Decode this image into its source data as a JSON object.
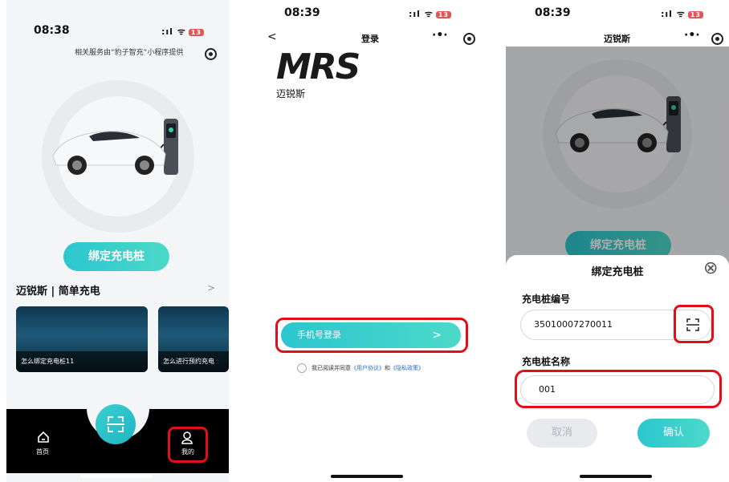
{
  "phone1": {
    "time": "08:38",
    "signal": ":ıl",
    "battery": "13",
    "provider_notice": "相关服务由“豹子智充”小程序提供",
    "bind_button": "绑定充电桩",
    "section_title": "迈锐斯 | 简单充电",
    "section_arrow": ">",
    "videos": [
      {
        "caption": "怎么绑定充电桩11"
      },
      {
        "caption": "怎么进行预约充电"
      }
    ],
    "tabs": {
      "home": "首页",
      "mine": "我的"
    },
    "colors": {
      "teal": "#2bc6cf",
      "highlight": "#e0101a"
    }
  },
  "phone2": {
    "time": "08:39",
    "signal": ":ıl",
    "battery": "13",
    "back": "<",
    "title": "登录",
    "logo_text": "MRS",
    "brand_name": "迈锐斯",
    "phone_login_button": "手机号登录",
    "phone_login_arrow": ">",
    "agreement_prefix": "我已阅读并同意",
    "user_agreement": "《用户协议》",
    "and": "和",
    "privacy_policy": "《隐私政策》",
    "agreement_checked": false
  },
  "phone3": {
    "time": "08:39",
    "signal": ":ıl",
    "battery": "13",
    "title": "迈锐斯",
    "bg_bind_button": "绑定充电桩",
    "sheet_title": "绑定充电桩",
    "close_symbol": "⊗",
    "pile_number_label": "充电桩编号",
    "pile_number_value": "35010007270011",
    "pile_name_label": "充电桩名称",
    "pile_name_value": "001",
    "cancel_button": "取消",
    "confirm_button": "确认"
  }
}
